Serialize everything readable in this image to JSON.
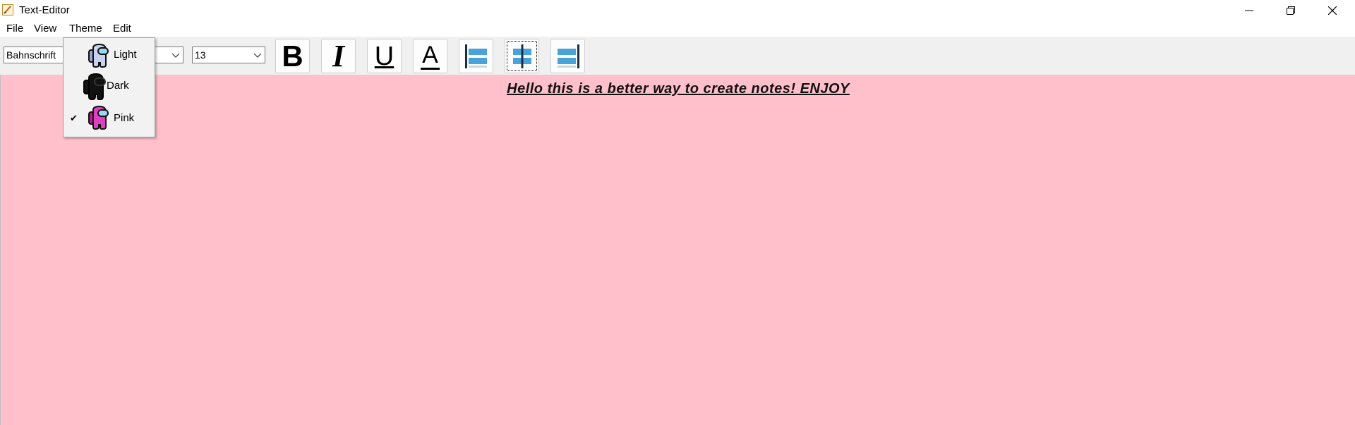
{
  "window": {
    "title": "Text-Editor",
    "controls": {
      "minimize": "minimize-icon",
      "restore": "restore-icon",
      "close": "close-icon"
    }
  },
  "menubar": {
    "items": [
      {
        "label": "File"
      },
      {
        "label": "View"
      },
      {
        "label": "Theme"
      },
      {
        "label": "Edit"
      }
    ]
  },
  "toolbar": {
    "font_family": "Bahnschrift",
    "font_size": "13",
    "buttons": [
      {
        "icon": "bold-icon",
        "label": "B"
      },
      {
        "icon": "italic-icon",
        "label": "I"
      },
      {
        "icon": "underline-icon",
        "label": "U"
      },
      {
        "icon": "font-color-icon",
        "label": "A"
      },
      {
        "icon": "align-left-icon"
      },
      {
        "icon": "align-center-icon"
      },
      {
        "icon": "align-right-icon"
      }
    ]
  },
  "theme_menu": {
    "items": [
      {
        "label": "Light",
        "checked": false,
        "color": "#b8c4e0"
      },
      {
        "label": "Dark",
        "checked": false,
        "color": "#111111"
      },
      {
        "label": "Pink",
        "checked": true,
        "color": "#e040c0"
      }
    ],
    "check_mark": "✔"
  },
  "editor": {
    "content": "Hello this is a better way to create notes! ENJOY",
    "background": "#ffc0cb"
  }
}
